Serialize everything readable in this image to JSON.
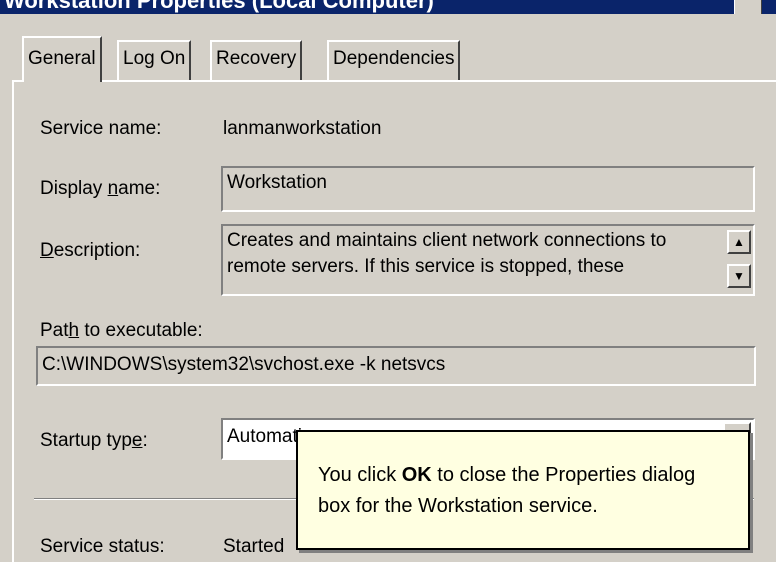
{
  "window": {
    "title": "Workstation Properties (Local Computer)"
  },
  "tabs": [
    {
      "label": "General",
      "active": true
    },
    {
      "label": "Log On",
      "active": false
    },
    {
      "label": "Recovery",
      "active": false
    },
    {
      "label": "Dependencies",
      "active": false
    }
  ],
  "general": {
    "service_name_label": "Service name:",
    "service_name_value": "lanmanworkstation",
    "display_name_label_pre": "Display ",
    "display_name_label_key": "n",
    "display_name_label_post": "ame:",
    "display_name_value": "Workstation",
    "description_label_key": "D",
    "description_label_post": "escription:",
    "description_value": "Creates and maintains client network connections to remote servers. If this service is stopped, these",
    "path_label_pre": "Pat",
    "path_label_key": "h",
    "path_label_post": " to executable:",
    "path_value": "C:\\WINDOWS\\system32\\svchost.exe -k netsvcs",
    "startup_label_pre": "Startup typ",
    "startup_label_key": "e",
    "startup_label_post": ":",
    "startup_value": "Automatic",
    "status_label": "Service status:",
    "status_value": "Started"
  },
  "callout": {
    "text_pre": "You click ",
    "text_bold": "OK",
    "text_post": " to close the Properties dialog box for the Workstation service."
  }
}
